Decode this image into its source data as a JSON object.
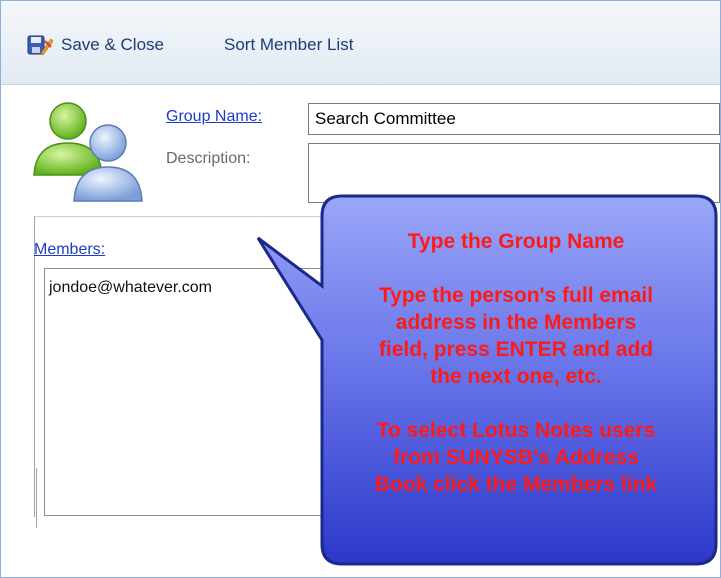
{
  "toolbar": {
    "save_close_label": "Save & Close",
    "sort_member_list_label": "Sort Member List"
  },
  "form": {
    "group_name_label": "Group Name:",
    "group_name_value": "Search Committee",
    "description_label": "Description:",
    "description_value": "",
    "members_label": "Members:",
    "members_value": "jondoe@whatever.com"
  },
  "callout": {
    "line1": "Type the Group Name",
    "line2": "Type the person's full email",
    "line3": "address in the Members",
    "line4": "field, press ENTER and add",
    "line5": "the next one, etc.",
    "line6": "To select Lotus Notes users",
    "line7": "from SUNYSB's Address",
    "line8": "Book click the Members link"
  },
  "colors": {
    "callout_fill_start": "#8f9df5",
    "callout_fill_end": "#2c37c9",
    "callout_text": "#ff1a1a",
    "link": "#1a3cc8"
  }
}
